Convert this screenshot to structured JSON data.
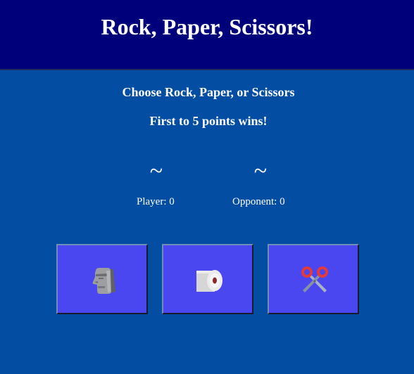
{
  "header": {
    "title": "Rock, Paper, Scissors!"
  },
  "instructions": {
    "line1": "Choose Rock, Paper, or Scissors",
    "line2": "First to 5 points wins!"
  },
  "board": {
    "player_choice": "~",
    "opponent_choice": "~",
    "player_label": "Player:",
    "player_score": "0",
    "opponent_label": "Opponent:",
    "opponent_score": "0"
  },
  "buttons": [
    {
      "id": "rock",
      "icon": "moai-icon"
    },
    {
      "id": "paper",
      "icon": "toilet-paper-roll-icon"
    },
    {
      "id": "scissors",
      "icon": "scissors-icon"
    }
  ],
  "colors": {
    "header_bg": "#00007a",
    "page_bg": "#034ea3",
    "button_bg": "#4b47f0",
    "text": "#ffffff"
  }
}
